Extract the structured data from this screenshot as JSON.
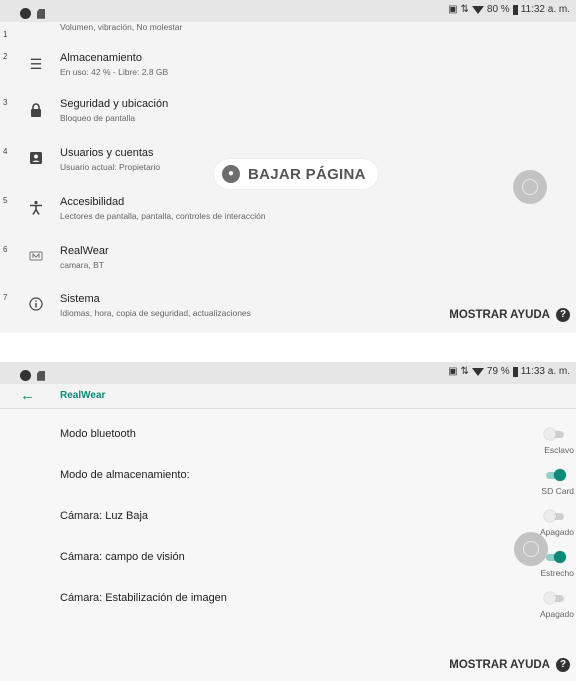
{
  "panel1": {
    "status": {
      "battery": "80 %",
      "time": "11:32 a. m."
    },
    "cut_row": {
      "num": "1",
      "subtitle": "Volumen, vibración, No molestar"
    },
    "items": [
      {
        "num": "2",
        "icon": "storage-icon",
        "title": "Almacenamiento",
        "subtitle": "En uso: 42 % - Libre: 2.8 GB"
      },
      {
        "num": "3",
        "icon": "lock-icon",
        "title": "Seguridad y ubicación",
        "subtitle": "Bloqueo de pantalla"
      },
      {
        "num": "4",
        "icon": "account-icon",
        "title": "Usuarios y cuentas",
        "subtitle": "Usuario actual: Propietario"
      },
      {
        "num": "5",
        "icon": "accessibility-icon",
        "title": "Accesibilidad",
        "subtitle": "Lectores de pantalla, pantalla, controles de interacción"
      },
      {
        "num": "6",
        "icon": "realwear-icon",
        "title": "RealWear",
        "subtitle": "camara, BT"
      },
      {
        "num": "7",
        "icon": "info-icon",
        "title": "Sistema",
        "subtitle": "Idiomas, hora, copia de seguridad, actualizaciones"
      }
    ],
    "voice_command": "BAJAR PÁGINA",
    "help_label": "MOSTRAR AYUDA"
  },
  "panel2": {
    "status": {
      "battery": "79 %",
      "time": "11:33 a. m."
    },
    "toolbar_title": "RealWear",
    "prefs": [
      {
        "title": "Modo bluetooth",
        "state": "Esclavo",
        "on": false
      },
      {
        "title": "Modo de almacenamiento:",
        "state": "SD Card",
        "on": true
      },
      {
        "title": "Cámara: Luz Baja",
        "state": "Apagado",
        "on": false
      },
      {
        "title": "Cámara: campo de visión",
        "state": "Estrecho",
        "on": true
      },
      {
        "title": "Cámara: Estabilización de imagen",
        "state": "Apagado",
        "on": false
      }
    ],
    "help_label": "MOSTRAR AYUDA"
  },
  "colors": {
    "accent": "#0b8a78",
    "panel_bg": "#f4f4f4",
    "statusbar_bg": "#e6e6e6"
  }
}
